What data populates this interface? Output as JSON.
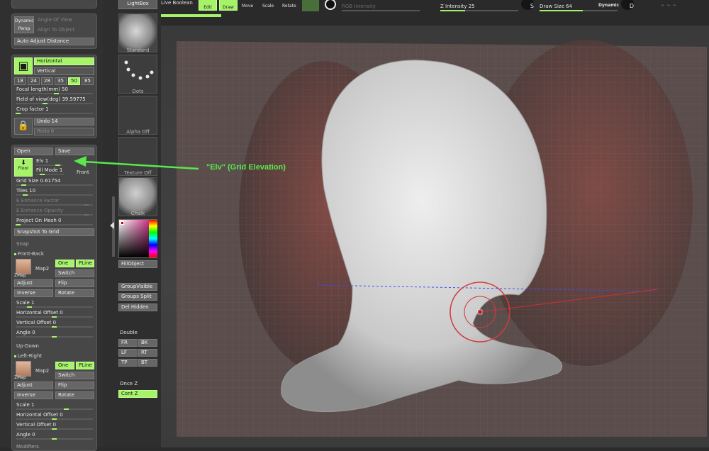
{
  "left_panel": {
    "persp_btn_top": "Dynamic",
    "persp_btn_bottom": "Persp",
    "angle_of_view": "Angle Of View",
    "align_to_object": "Align To Object",
    "auto_adjust_distance": "Auto Adjust Distance",
    "horizontal": "Horizontal",
    "vertical": "Vertical",
    "focal_presets": [
      "18",
      "24",
      "28",
      "35",
      "50",
      "85"
    ],
    "focal_length": "Focal length(mm) 50",
    "field_of_view": "Field of view(deg) 39.59775",
    "crop_factor": "Crop factor 1",
    "undo": "Undo 14",
    "redo": "Redo 0",
    "open": "Open",
    "save": "Save",
    "floor": "Floor",
    "elv": "Elv 1",
    "fill_mode": "Fill Mode 1",
    "front": "Front",
    "grid_size": "Grid Size 0.61754",
    "tiles": "Tiles 10",
    "e_enhance_factor": "E Enhance Factor",
    "e_enhance_opacity": "E Enhance Opacity",
    "project_on_mesh": "Project On Mesh 0",
    "snapshot_to_grid": "Snapshot To Grid",
    "snap": "Snap",
    "front_back": "Front-Back",
    "map2": "Map2",
    "zmap": "ZMap",
    "one": "One",
    "pline": "PLine",
    "switch": "Switch",
    "adjust": "Adjust",
    "flip": "Flip",
    "inverse": "Inverse",
    "rotate": "Rotate",
    "scale": "Scale 1",
    "horizontal_offset": "Horizontal Offset 0",
    "vertical_offset": "Vertical Offset 0",
    "angle": "Angle 0",
    "up_down": "Up-Down",
    "left_right": "Left-Right",
    "modifiers": "Modifiers"
  },
  "mid_panel": {
    "lightbox": "LightBox",
    "standard": "Standard",
    "dots": "Dots",
    "alpha_off": "Alpha Off",
    "texture_off": "Texture Off",
    "chalk": "Chalk",
    "fill_object": "FillObject",
    "group_visible": "GroupVisible",
    "groups_split": "Groups Split",
    "del_hidden": "Del Hidden",
    "double": "Double",
    "fr": "FR",
    "bk": "BK",
    "lf": "LF",
    "rt": "RT",
    "tp": "TP",
    "bt": "BT",
    "once_z": "Once Z",
    "cont_z": "Cont Z"
  },
  "top_bar": {
    "live_boolean": "Live Boolean",
    "edit": "Edit",
    "draw": "Draw",
    "move": "Move",
    "scale": "Scale",
    "rotate": "Rotate",
    "rgb_intensity": "RGB Intensity",
    "z_intensity": "Z Intensity 25",
    "s": "S",
    "draw_size": "Draw Size 64",
    "dynamic": "Dynamic",
    "d": "D",
    "z_intensity_frac": 0.32,
    "draw_size_frac": 0.55
  },
  "annotation": {
    "text": "\"Elv\" (Grid Elevation)",
    "color": "#59e84d"
  },
  "colors": {
    "accent": "#a6f36a",
    "panel": "#474747",
    "viewport": "#3e3e3e",
    "annotation": "#59e84d"
  }
}
